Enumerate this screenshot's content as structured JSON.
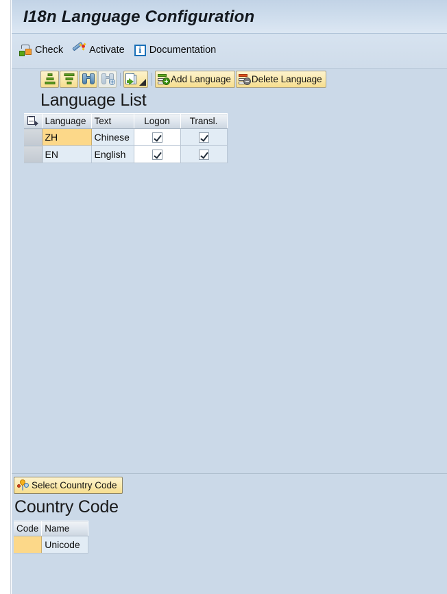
{
  "window": {
    "title": "I18n Language Configuration"
  },
  "action_bar": {
    "items": [
      {
        "label": "Check",
        "icon": "check-icon"
      },
      {
        "label": "Activate",
        "icon": "magic-wand-icon"
      },
      {
        "label": "Documentation",
        "icon": "info-icon"
      }
    ]
  },
  "toolbar": {
    "buttons": [
      {
        "label": "",
        "icon": "sort-ascending-icon",
        "enabled": true
      },
      {
        "label": "",
        "icon": "sort-descending-icon",
        "enabled": true
      },
      {
        "label": "",
        "icon": "find-icon",
        "enabled": true
      },
      {
        "label": "",
        "icon": "find-next-icon",
        "enabled": false
      },
      {
        "label": "",
        "icon": "export-icon",
        "enabled": true
      },
      {
        "label": "Add Language",
        "icon": "add-language-icon",
        "enabled": true
      },
      {
        "label": "Delete Language",
        "icon": "delete-language-icon",
        "enabled": true
      }
    ]
  },
  "language_list": {
    "title": "Language List",
    "columns": [
      "",
      "Language",
      "Text",
      "Logon",
      "Transl."
    ],
    "rows": [
      {
        "language": "ZH",
        "text": "Chinese",
        "logon": true,
        "transl": true,
        "highlighted": true
      },
      {
        "language": "EN",
        "text": "English",
        "logon": true,
        "transl": true,
        "highlighted": false
      }
    ]
  },
  "country_code": {
    "button_label": "Select Country Code",
    "button_icon": "select-country-code-icon",
    "title": "Country Code",
    "columns": [
      "Code",
      "Name"
    ],
    "rows": [
      {
        "code": "",
        "name": "Unicode",
        "code_highlighted": true
      }
    ]
  },
  "colors": {
    "page_background": "#cbd9e8",
    "title_bar": "#cddcec",
    "highlight_cell": "#fcd889",
    "button_yellow": "#fae9ad",
    "grid_cell": "#e2ecf5",
    "grid_header": "#dfe6ee"
  }
}
